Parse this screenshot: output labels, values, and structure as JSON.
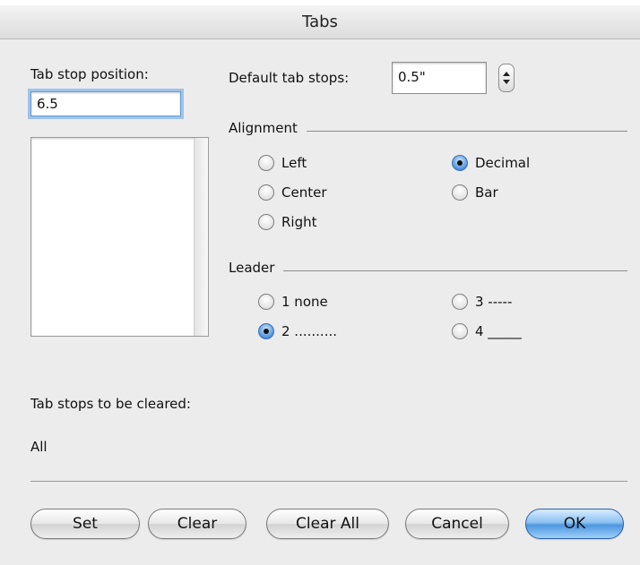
{
  "window": {
    "title": "Tabs"
  },
  "tab_stop": {
    "label": "Tab stop position:",
    "value": "6.5",
    "list": []
  },
  "default_tab_stops": {
    "label": "Default tab stops:",
    "value": "0.5\""
  },
  "alignment": {
    "label": "Alignment",
    "options": [
      "Left",
      "Center",
      "Right",
      "Decimal",
      "Bar"
    ],
    "selected": "Decimal"
  },
  "leader": {
    "label": "Leader",
    "options": [
      "1 none",
      "2 ..........",
      "3 -----",
      "4 _____"
    ],
    "selected": "2 .........."
  },
  "cleared": {
    "label": "Tab stops to be cleared:",
    "value": "All"
  },
  "buttons": {
    "set": "Set",
    "clear": "Clear",
    "clear_all": "Clear All",
    "cancel": "Cancel",
    "ok": "OK"
  },
  "colors": {
    "window_bg": "#ececec",
    "focus_ring": "#9ec3ea",
    "default_button": "#4d96e0",
    "radio_selected": "#4f93dc"
  }
}
